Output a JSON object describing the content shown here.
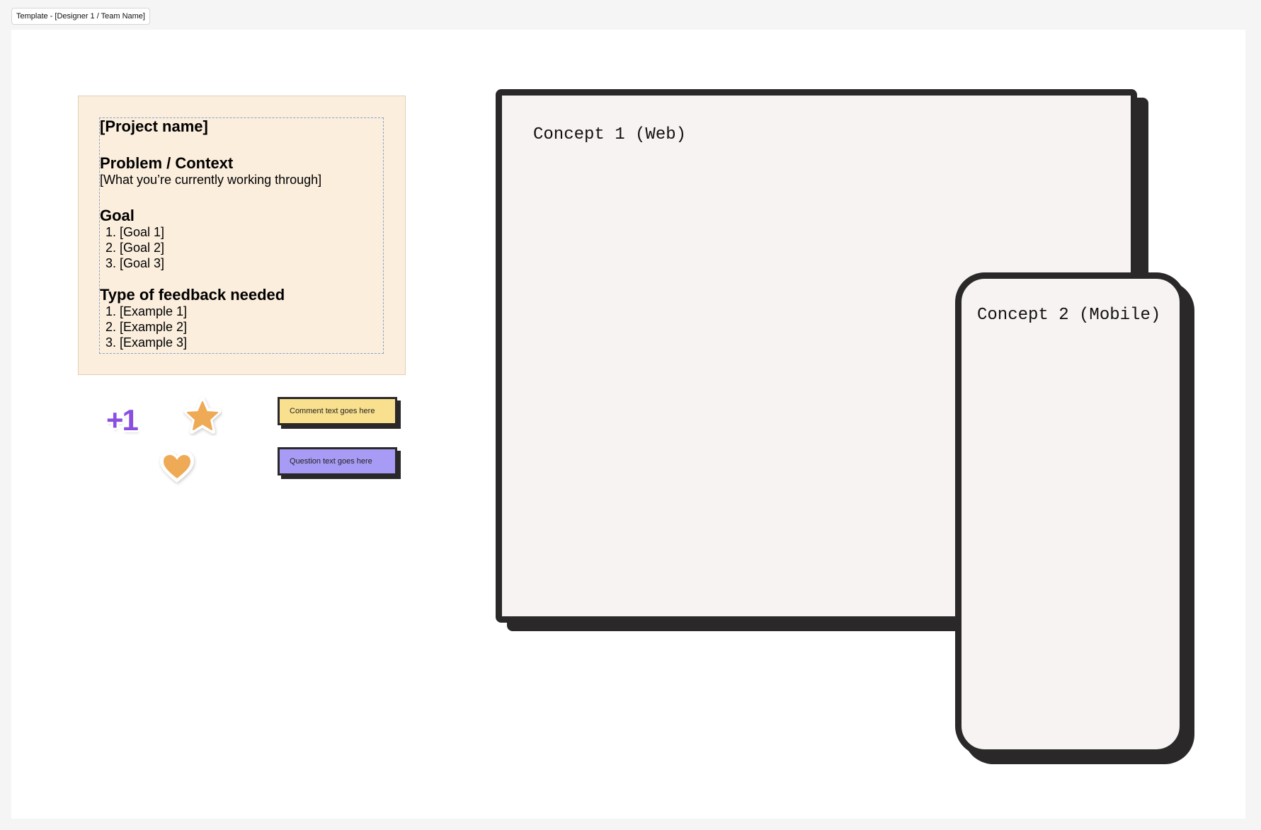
{
  "frame": {
    "label": "Template - [Designer 1 / Team Name]"
  },
  "brief": {
    "project_name": "[Project name]",
    "problem_heading": "Problem / Context",
    "problem_text": "[What you’re currently working through]",
    "goal_heading": "Goal",
    "goals": [
      "[Goal 1]",
      "[Goal 2]",
      "[Goal 3]"
    ],
    "feedback_heading": "Type of feedback needed",
    "feedback_examples": [
      "[Example 1]",
      "[Example 2]",
      "[Example 3]"
    ]
  },
  "stickers": {
    "plus_one": "+1",
    "star_icon": "star-icon",
    "heart_icon": "heart-icon",
    "colors": {
      "plus_one": "#8a4fe0",
      "star": "#eeaa55",
      "heart": "#eeaa55"
    }
  },
  "notes": {
    "comment": {
      "text": "Comment text goes here",
      "color": "#f9e08e"
    },
    "question": {
      "text": "Question text goes here",
      "color": "#a79bf5"
    }
  },
  "concepts": {
    "web": {
      "label": "Concept 1 (Web)"
    },
    "mobile": {
      "label": "Concept 2 (Mobile)"
    }
  }
}
